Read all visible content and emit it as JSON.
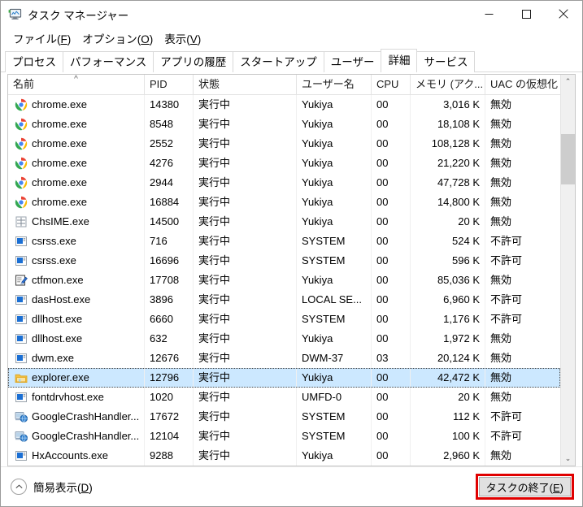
{
  "window": {
    "title": "タスク マネージャー",
    "icon": "task-manager-icon",
    "minimize_label": "最小化",
    "maximize_label": "最大化",
    "close_label": "閉じる"
  },
  "menu": [
    {
      "label": "ファイル(F)",
      "text": "ファイル(",
      "accel": "F",
      "tail": ")"
    },
    {
      "label": "オプション(O)",
      "text": "オプション(",
      "accel": "O",
      "tail": ")"
    },
    {
      "label": "表示(V)",
      "text": "表示(",
      "accel": "V",
      "tail": ")"
    }
  ],
  "tabs": [
    {
      "label": "プロセス",
      "active": false
    },
    {
      "label": "パフォーマンス",
      "active": false
    },
    {
      "label": "アプリの履歴",
      "active": false
    },
    {
      "label": "スタートアップ",
      "active": false
    },
    {
      "label": "ユーザー",
      "active": false
    },
    {
      "label": "詳細",
      "active": true
    },
    {
      "label": "サービス",
      "active": false
    }
  ],
  "columns": [
    {
      "key": "name",
      "label": "名前",
      "align": "left",
      "sorted": true,
      "sort_dir": "asc"
    },
    {
      "key": "pid",
      "label": "PID",
      "align": "left",
      "sorted": false
    },
    {
      "key": "state",
      "label": "状態",
      "align": "left",
      "sorted": false
    },
    {
      "key": "user",
      "label": "ユーザー名",
      "align": "left",
      "sorted": false
    },
    {
      "key": "cpu",
      "label": "CPU",
      "align": "left",
      "sorted": false
    },
    {
      "key": "mem",
      "label": "メモリ (アク...",
      "align": "right",
      "sorted": false
    },
    {
      "key": "uac",
      "label": "UAC の仮想化",
      "align": "left",
      "sorted": false
    }
  ],
  "sort_caret": "^",
  "rows": [
    {
      "icon": "chrome-icon",
      "name": "chrome.exe",
      "pid": "14380",
      "state": "実行中",
      "user": "Yukiya",
      "cpu": "00",
      "mem": "3,016 K",
      "uac": "無効",
      "selected": false
    },
    {
      "icon": "chrome-icon",
      "name": "chrome.exe",
      "pid": "8548",
      "state": "実行中",
      "user": "Yukiya",
      "cpu": "00",
      "mem": "18,108 K",
      "uac": "無効",
      "selected": false
    },
    {
      "icon": "chrome-icon",
      "name": "chrome.exe",
      "pid": "2552",
      "state": "実行中",
      "user": "Yukiya",
      "cpu": "00",
      "mem": "108,128 K",
      "uac": "無効",
      "selected": false
    },
    {
      "icon": "chrome-icon",
      "name": "chrome.exe",
      "pid": "4276",
      "state": "実行中",
      "user": "Yukiya",
      "cpu": "00",
      "mem": "21,220 K",
      "uac": "無効",
      "selected": false
    },
    {
      "icon": "chrome-icon",
      "name": "chrome.exe",
      "pid": "2944",
      "state": "実行中",
      "user": "Yukiya",
      "cpu": "00",
      "mem": "47,728 K",
      "uac": "無効",
      "selected": false
    },
    {
      "icon": "chrome-icon",
      "name": "chrome.exe",
      "pid": "16884",
      "state": "実行中",
      "user": "Yukiya",
      "cpu": "00",
      "mem": "14,800 K",
      "uac": "無効",
      "selected": false
    },
    {
      "icon": "ime-icon",
      "name": "ChsIME.exe",
      "pid": "14500",
      "state": "実行中",
      "user": "Yukiya",
      "cpu": "00",
      "mem": "20 K",
      "uac": "無効",
      "selected": false
    },
    {
      "icon": "generic-exe-icon",
      "name": "csrss.exe",
      "pid": "716",
      "state": "実行中",
      "user": "SYSTEM",
      "cpu": "00",
      "mem": "524 K",
      "uac": "不許可",
      "selected": false
    },
    {
      "icon": "generic-exe-icon",
      "name": "csrss.exe",
      "pid": "16696",
      "state": "実行中",
      "user": "SYSTEM",
      "cpu": "00",
      "mem": "596 K",
      "uac": "不許可",
      "selected": false
    },
    {
      "icon": "ctfmon-icon",
      "name": "ctfmon.exe",
      "pid": "17708",
      "state": "実行中",
      "user": "Yukiya",
      "cpu": "00",
      "mem": "85,036 K",
      "uac": "無効",
      "selected": false
    },
    {
      "icon": "generic-exe-icon",
      "name": "dasHost.exe",
      "pid": "3896",
      "state": "実行中",
      "user": "LOCAL SE...",
      "cpu": "00",
      "mem": "6,960 K",
      "uac": "不許可",
      "selected": false
    },
    {
      "icon": "generic-exe-icon",
      "name": "dllhost.exe",
      "pid": "6660",
      "state": "実行中",
      "user": "SYSTEM",
      "cpu": "00",
      "mem": "1,176 K",
      "uac": "不許可",
      "selected": false
    },
    {
      "icon": "generic-exe-icon",
      "name": "dllhost.exe",
      "pid": "632",
      "state": "実行中",
      "user": "Yukiya",
      "cpu": "00",
      "mem": "1,972 K",
      "uac": "無効",
      "selected": false
    },
    {
      "icon": "generic-exe-icon",
      "name": "dwm.exe",
      "pid": "12676",
      "state": "実行中",
      "user": "DWM-37",
      "cpu": "03",
      "mem": "20,124 K",
      "uac": "無効",
      "selected": false
    },
    {
      "icon": "folder-icon",
      "name": "explorer.exe",
      "pid": "12796",
      "state": "実行中",
      "user": "Yukiya",
      "cpu": "00",
      "mem": "42,472 K",
      "uac": "無効",
      "selected": true
    },
    {
      "icon": "generic-exe-icon",
      "name": "fontdrvhost.exe",
      "pid": "1020",
      "state": "実行中",
      "user": "UMFD-0",
      "cpu": "00",
      "mem": "20 K",
      "uac": "無効",
      "selected": false
    },
    {
      "icon": "crash-handler-icon",
      "name": "GoogleCrashHandler....",
      "pid": "17672",
      "state": "実行中",
      "user": "SYSTEM",
      "cpu": "00",
      "mem": "112 K",
      "uac": "不許可",
      "selected": false
    },
    {
      "icon": "crash-handler-icon",
      "name": "GoogleCrashHandler...",
      "pid": "12104",
      "state": "実行中",
      "user": "SYSTEM",
      "cpu": "00",
      "mem": "100 K",
      "uac": "不許可",
      "selected": false
    },
    {
      "icon": "generic-exe-icon",
      "name": "HxAccounts.exe",
      "pid": "9288",
      "state": "実行中",
      "user": "Yukiya",
      "cpu": "00",
      "mem": "2,960 K",
      "uac": "無効",
      "selected": false
    }
  ],
  "scrollbar": {
    "up_arrow": "⌃",
    "down_arrow": "⌄"
  },
  "statusbar": {
    "fewer_details_text": "簡易表示(",
    "fewer_details_accel": "D",
    "fewer_details_tail": ")",
    "fewer_details_label": "簡易表示(D)",
    "end_task_text": "タスクの終了(",
    "end_task_accel": "E",
    "end_task_tail": ")",
    "end_task_label": "タスクの終了(E)",
    "chevron_up": "⌃"
  },
  "annotation": {
    "color": "#e00000",
    "target": "end-task-button"
  }
}
